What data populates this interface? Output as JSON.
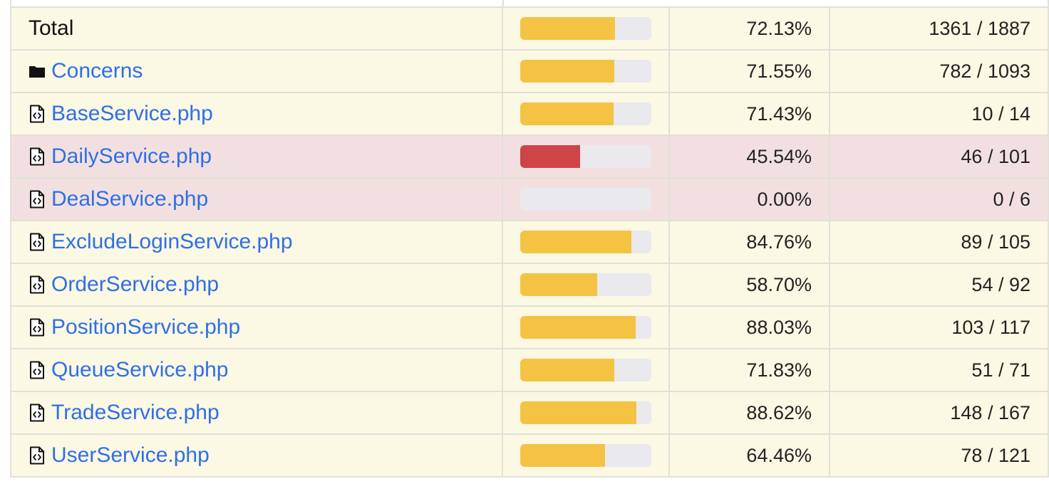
{
  "colors": {
    "warning_fill": "#f5c343",
    "danger_fill": "#cf4447",
    "bar_track": "#e9e9ee",
    "warning_row_bg": "#fbf8e3",
    "danger_row_bg": "#f2e0e0",
    "link": "#2f6fe6"
  },
  "rows": [
    {
      "kind": "total",
      "name": "Total",
      "percent_text": "72.13%",
      "fraction": "1361 / 1887",
      "coverage": 72.13,
      "status": "warning"
    },
    {
      "kind": "folder",
      "name": "Concerns",
      "percent_text": "71.55%",
      "fraction": "782 / 1093",
      "coverage": 71.55,
      "status": "warning",
      "icon": "folder-icon"
    },
    {
      "kind": "file",
      "name": "BaseService.php",
      "percent_text": "71.43%",
      "fraction": "10 / 14",
      "coverage": 71.43,
      "status": "warning",
      "icon": "code-file-icon"
    },
    {
      "kind": "file",
      "name": "DailyService.php",
      "percent_text": "45.54%",
      "fraction": "46 / 101",
      "coverage": 45.54,
      "status": "danger",
      "icon": "code-file-icon"
    },
    {
      "kind": "file",
      "name": "DealService.php",
      "percent_text": "0.00%",
      "fraction": "0 / 6",
      "coverage": 0.0,
      "status": "danger",
      "icon": "code-file-icon"
    },
    {
      "kind": "file",
      "name": "ExcludeLoginService.php",
      "percent_text": "84.76%",
      "fraction": "89 / 105",
      "coverage": 84.76,
      "status": "warning",
      "icon": "code-file-icon"
    },
    {
      "kind": "file",
      "name": "OrderService.php",
      "percent_text": "58.70%",
      "fraction": "54 / 92",
      "coverage": 58.7,
      "status": "warning",
      "icon": "code-file-icon"
    },
    {
      "kind": "file",
      "name": "PositionService.php",
      "percent_text": "88.03%",
      "fraction": "103 / 117",
      "coverage": 88.03,
      "status": "warning",
      "icon": "code-file-icon"
    },
    {
      "kind": "file",
      "name": "QueueService.php",
      "percent_text": "71.83%",
      "fraction": "51 / 71",
      "coverage": 71.83,
      "status": "warning",
      "icon": "code-file-icon"
    },
    {
      "kind": "file",
      "name": "TradeService.php",
      "percent_text": "88.62%",
      "fraction": "148 / 167",
      "coverage": 88.62,
      "status": "warning",
      "icon": "code-file-icon"
    },
    {
      "kind": "file",
      "name": "UserService.php",
      "percent_text": "64.46%",
      "fraction": "78 / 121",
      "coverage": 64.46,
      "status": "warning",
      "icon": "code-file-icon"
    }
  ]
}
